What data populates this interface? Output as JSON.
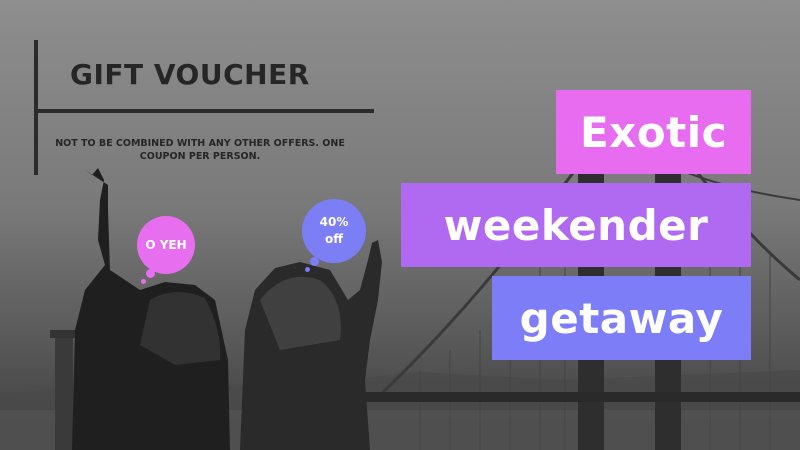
{
  "voucher": {
    "title": "GIFT VOUCHER",
    "terms": "NOT TO BE COMBINED WITH ANY OTHER OFFERS. ONE COUPON PER PERSON."
  },
  "bubbles": {
    "left": "O YEH",
    "right_line1": "40%",
    "right_line2": "off"
  },
  "headline": {
    "line1": "Exotic",
    "line2": "weekender",
    "line3": "getaway"
  },
  "colors": {
    "pink": "#e86cf0",
    "violet": "#b06af2",
    "periwinkle": "#7d7ef7",
    "dark_text": "#262626"
  }
}
